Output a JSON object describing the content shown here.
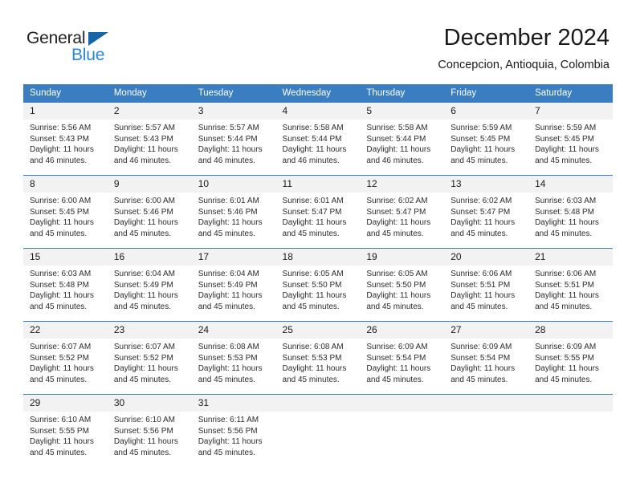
{
  "brand": {
    "name_top": "General",
    "name_bottom": "Blue",
    "triangle_color": "#1565a8",
    "blue_text_color": "#2a86d8"
  },
  "header": {
    "title": "December 2024",
    "subtitle": "Concepcion, Antioquia, Colombia",
    "accent_color": "#3a7dc0",
    "daynum_band_color": "#f2f2f2"
  },
  "calendar": {
    "weekday_headers": [
      "Sunday",
      "Monday",
      "Tuesday",
      "Wednesday",
      "Thursday",
      "Friday",
      "Saturday"
    ],
    "weeks": [
      [
        {
          "day": "1",
          "sunrise": "Sunrise: 5:56 AM",
          "sunset": "Sunset: 5:43 PM",
          "daylight_line1": "Daylight: 11 hours",
          "daylight_line2": "and 46 minutes."
        },
        {
          "day": "2",
          "sunrise": "Sunrise: 5:57 AM",
          "sunset": "Sunset: 5:43 PM",
          "daylight_line1": "Daylight: 11 hours",
          "daylight_line2": "and 46 minutes."
        },
        {
          "day": "3",
          "sunrise": "Sunrise: 5:57 AM",
          "sunset": "Sunset: 5:44 PM",
          "daylight_line1": "Daylight: 11 hours",
          "daylight_line2": "and 46 minutes."
        },
        {
          "day": "4",
          "sunrise": "Sunrise: 5:58 AM",
          "sunset": "Sunset: 5:44 PM",
          "daylight_line1": "Daylight: 11 hours",
          "daylight_line2": "and 46 minutes."
        },
        {
          "day": "5",
          "sunrise": "Sunrise: 5:58 AM",
          "sunset": "Sunset: 5:44 PM",
          "daylight_line1": "Daylight: 11 hours",
          "daylight_line2": "and 46 minutes."
        },
        {
          "day": "6",
          "sunrise": "Sunrise: 5:59 AM",
          "sunset": "Sunset: 5:45 PM",
          "daylight_line1": "Daylight: 11 hours",
          "daylight_line2": "and 45 minutes."
        },
        {
          "day": "7",
          "sunrise": "Sunrise: 5:59 AM",
          "sunset": "Sunset: 5:45 PM",
          "daylight_line1": "Daylight: 11 hours",
          "daylight_line2": "and 45 minutes."
        }
      ],
      [
        {
          "day": "8",
          "sunrise": "Sunrise: 6:00 AM",
          "sunset": "Sunset: 5:45 PM",
          "daylight_line1": "Daylight: 11 hours",
          "daylight_line2": "and 45 minutes."
        },
        {
          "day": "9",
          "sunrise": "Sunrise: 6:00 AM",
          "sunset": "Sunset: 5:46 PM",
          "daylight_line1": "Daylight: 11 hours",
          "daylight_line2": "and 45 minutes."
        },
        {
          "day": "10",
          "sunrise": "Sunrise: 6:01 AM",
          "sunset": "Sunset: 5:46 PM",
          "daylight_line1": "Daylight: 11 hours",
          "daylight_line2": "and 45 minutes."
        },
        {
          "day": "11",
          "sunrise": "Sunrise: 6:01 AM",
          "sunset": "Sunset: 5:47 PM",
          "daylight_line1": "Daylight: 11 hours",
          "daylight_line2": "and 45 minutes."
        },
        {
          "day": "12",
          "sunrise": "Sunrise: 6:02 AM",
          "sunset": "Sunset: 5:47 PM",
          "daylight_line1": "Daylight: 11 hours",
          "daylight_line2": "and 45 minutes."
        },
        {
          "day": "13",
          "sunrise": "Sunrise: 6:02 AM",
          "sunset": "Sunset: 5:47 PM",
          "daylight_line1": "Daylight: 11 hours",
          "daylight_line2": "and 45 minutes."
        },
        {
          "day": "14",
          "sunrise": "Sunrise: 6:03 AM",
          "sunset": "Sunset: 5:48 PM",
          "daylight_line1": "Daylight: 11 hours",
          "daylight_line2": "and 45 minutes."
        }
      ],
      [
        {
          "day": "15",
          "sunrise": "Sunrise: 6:03 AM",
          "sunset": "Sunset: 5:48 PM",
          "daylight_line1": "Daylight: 11 hours",
          "daylight_line2": "and 45 minutes."
        },
        {
          "day": "16",
          "sunrise": "Sunrise: 6:04 AM",
          "sunset": "Sunset: 5:49 PM",
          "daylight_line1": "Daylight: 11 hours",
          "daylight_line2": "and 45 minutes."
        },
        {
          "day": "17",
          "sunrise": "Sunrise: 6:04 AM",
          "sunset": "Sunset: 5:49 PM",
          "daylight_line1": "Daylight: 11 hours",
          "daylight_line2": "and 45 minutes."
        },
        {
          "day": "18",
          "sunrise": "Sunrise: 6:05 AM",
          "sunset": "Sunset: 5:50 PM",
          "daylight_line1": "Daylight: 11 hours",
          "daylight_line2": "and 45 minutes."
        },
        {
          "day": "19",
          "sunrise": "Sunrise: 6:05 AM",
          "sunset": "Sunset: 5:50 PM",
          "daylight_line1": "Daylight: 11 hours",
          "daylight_line2": "and 45 minutes."
        },
        {
          "day": "20",
          "sunrise": "Sunrise: 6:06 AM",
          "sunset": "Sunset: 5:51 PM",
          "daylight_line1": "Daylight: 11 hours",
          "daylight_line2": "and 45 minutes."
        },
        {
          "day": "21",
          "sunrise": "Sunrise: 6:06 AM",
          "sunset": "Sunset: 5:51 PM",
          "daylight_line1": "Daylight: 11 hours",
          "daylight_line2": "and 45 minutes."
        }
      ],
      [
        {
          "day": "22",
          "sunrise": "Sunrise: 6:07 AM",
          "sunset": "Sunset: 5:52 PM",
          "daylight_line1": "Daylight: 11 hours",
          "daylight_line2": "and 45 minutes."
        },
        {
          "day": "23",
          "sunrise": "Sunrise: 6:07 AM",
          "sunset": "Sunset: 5:52 PM",
          "daylight_line1": "Daylight: 11 hours",
          "daylight_line2": "and 45 minutes."
        },
        {
          "day": "24",
          "sunrise": "Sunrise: 6:08 AM",
          "sunset": "Sunset: 5:53 PM",
          "daylight_line1": "Daylight: 11 hours",
          "daylight_line2": "and 45 minutes."
        },
        {
          "day": "25",
          "sunrise": "Sunrise: 6:08 AM",
          "sunset": "Sunset: 5:53 PM",
          "daylight_line1": "Daylight: 11 hours",
          "daylight_line2": "and 45 minutes."
        },
        {
          "day": "26",
          "sunrise": "Sunrise: 6:09 AM",
          "sunset": "Sunset: 5:54 PM",
          "daylight_line1": "Daylight: 11 hours",
          "daylight_line2": "and 45 minutes."
        },
        {
          "day": "27",
          "sunrise": "Sunrise: 6:09 AM",
          "sunset": "Sunset: 5:54 PM",
          "daylight_line1": "Daylight: 11 hours",
          "daylight_line2": "and 45 minutes."
        },
        {
          "day": "28",
          "sunrise": "Sunrise: 6:09 AM",
          "sunset": "Sunset: 5:55 PM",
          "daylight_line1": "Daylight: 11 hours",
          "daylight_line2": "and 45 minutes."
        }
      ],
      [
        {
          "day": "29",
          "sunrise": "Sunrise: 6:10 AM",
          "sunset": "Sunset: 5:55 PM",
          "daylight_line1": "Daylight: 11 hours",
          "daylight_line2": "and 45 minutes."
        },
        {
          "day": "30",
          "sunrise": "Sunrise: 6:10 AM",
          "sunset": "Sunset: 5:56 PM",
          "daylight_line1": "Daylight: 11 hours",
          "daylight_line2": "and 45 minutes."
        },
        {
          "day": "31",
          "sunrise": "Sunrise: 6:11 AM",
          "sunset": "Sunset: 5:56 PM",
          "daylight_line1": "Daylight: 11 hours",
          "daylight_line2": "and 45 minutes."
        },
        {
          "day": "",
          "sunrise": "",
          "sunset": "",
          "daylight_line1": "",
          "daylight_line2": ""
        },
        {
          "day": "",
          "sunrise": "",
          "sunset": "",
          "daylight_line1": "",
          "daylight_line2": ""
        },
        {
          "day": "",
          "sunrise": "",
          "sunset": "",
          "daylight_line1": "",
          "daylight_line2": ""
        },
        {
          "day": "",
          "sunrise": "",
          "sunset": "",
          "daylight_line1": "",
          "daylight_line2": ""
        }
      ]
    ]
  }
}
